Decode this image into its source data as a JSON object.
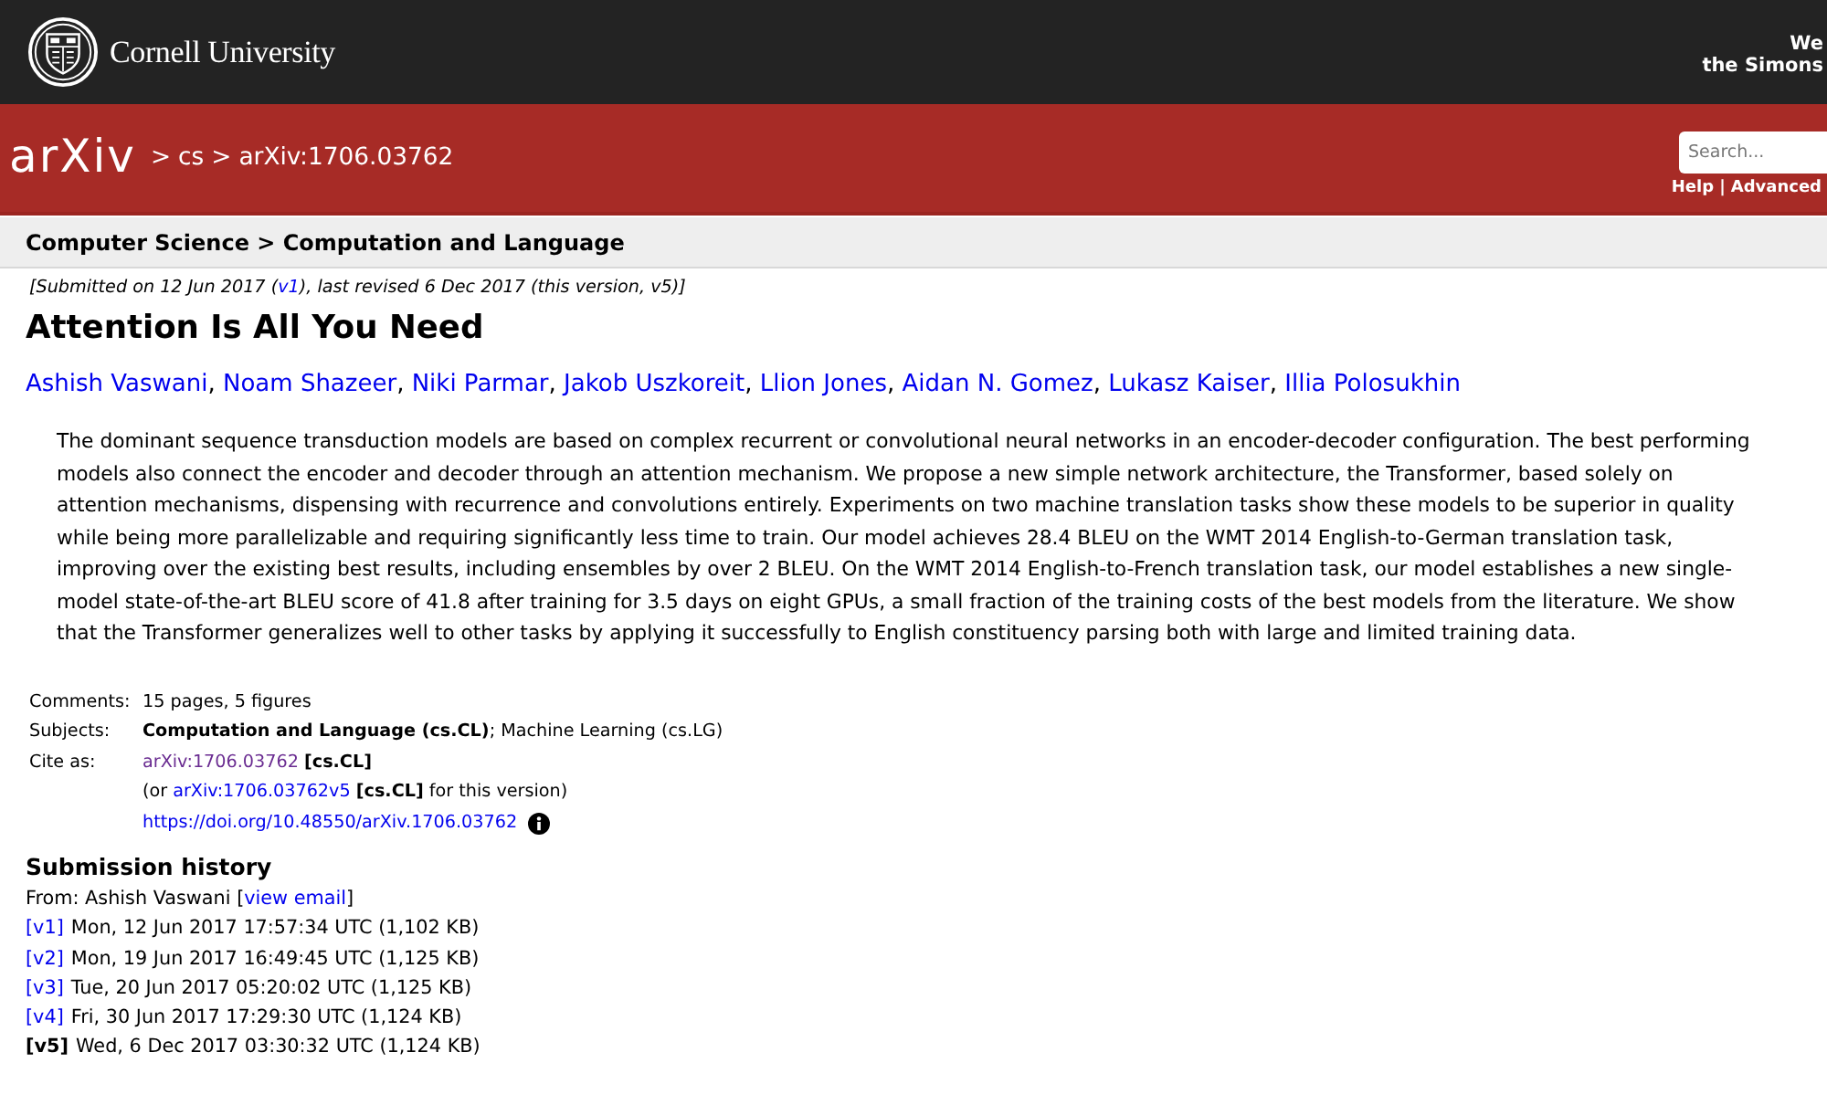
{
  "header": {
    "institution": "Cornell University",
    "support_message": [
      "We",
      "the Simons"
    ]
  },
  "nav": {
    "logo": "arXiv",
    "separator": ">",
    "breadcrumbs": [
      "cs",
      "arXiv:1706.03762"
    ],
    "search": {
      "placeholder": "Search..."
    },
    "links": [
      "Help",
      "Advanced"
    ],
    "link_separator": "|"
  },
  "subheader": {
    "title": "Computer Science > Computation and Language"
  },
  "paper": {
    "dateline": {
      "before": "[Submitted on 12 Jun 2017 (",
      "link": "v1",
      "after": "), last revised 6 Dec 2017 (this version, v5)]"
    },
    "title": "Attention Is All You Need",
    "authors": {
      "names": [
        "Ashish Vaswani",
        "Noam Shazeer",
        "Niki Parmar",
        "Jakob Uszkoreit",
        "Llion Jones",
        "Aidan N. Gomez",
        "Lukasz Kaiser",
        "Illia Polosukhin"
      ],
      "separator": ","
    },
    "abstract": "The dominant sequence transduction models are based on complex recurrent or convolutional neural networks in an encoder-decoder configuration. The best performing models also connect the encoder and decoder through an attention mechanism. We propose a new simple network architecture, the Transformer, based solely on attention mechanisms, dispensing with recurrence and convolutions entirely. Experiments on two machine translation tasks show these models to be superior in quality while being more parallelizable and requiring significantly less time to train. Our model achieves 28.4 BLEU on the WMT 2014 English-to-German translation task, improving over the existing best results, including ensembles by over 2 BLEU. On the WMT 2014 English-to-French translation task, our model establishes a new single-model state-of-the-art BLEU score of 41.8 after training for 3.5 days on eight GPUs, a small fraction of the training costs of the best models from the literature. We show that the Transformer generalizes well to other tasks by applying it successfully to English constituency parsing both with large and limited training data."
  },
  "metadata": [
    {
      "label": "Comments:",
      "kind": "text",
      "value": "15 pages, 5 figures"
    },
    {
      "label": "Subjects:",
      "kind": "text",
      "value": "**Computation and Language (cs.CL)**; Machine Learning (cs.LG)"
    },
    {
      "label": "Cite as:",
      "kind": "citations",
      "lines": [
        {
          "link": "arXiv:1706.03762",
          "visited": true,
          "after": " **[cs.CL]**"
        },
        {
          "before": "(or ",
          "link": "arXiv:1706.03762v5",
          "visited": false,
          "after": " **[cs.CL]** for this version)"
        },
        {
          "link": "https://doi.org/10.48550/arXiv.1706.03762",
          "visited": false,
          "info": true
        }
      ]
    }
  ],
  "history": {
    "title": "Submission history",
    "submitter": {
      "before": "From: Ashish Vaswani [",
      "link": "view email",
      "after": "]"
    },
    "versions": [
      {
        "label": "[v1]",
        "current": false,
        "date": "Mon, 12 Jun 2017 17:57:34 UTC (1,102 KB)"
      },
      {
        "label": "[v2]",
        "current": false,
        "date": "Mon, 19 Jun 2017 16:49:45 UTC (1,125 KB)"
      },
      {
        "label": "[v3]",
        "current": false,
        "date": "Tue, 20 Jun 2017 05:20:02 UTC (1,125 KB)"
      },
      {
        "label": "[v4]",
        "current": false,
        "date": "Fri, 30 Jun 2017 17:29:30 UTC (1,124 KB)"
      },
      {
        "label": "[v5]",
        "current": true,
        "date": "Wed, 6 Dec 2017 03:30:32 UTC (1,124 KB)"
      }
    ]
  }
}
